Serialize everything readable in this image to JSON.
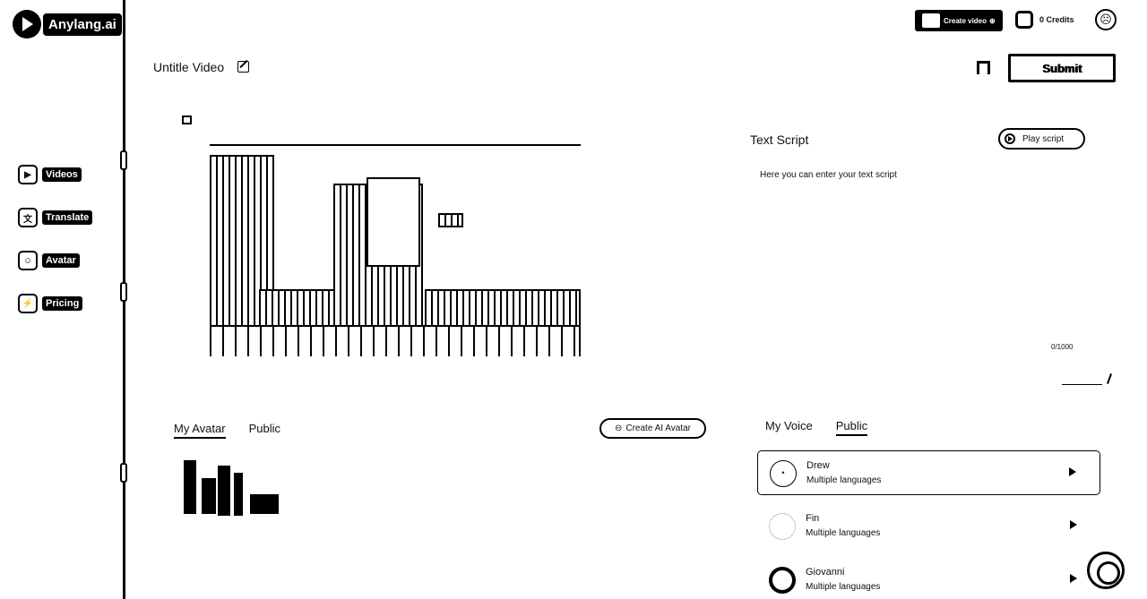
{
  "app": {
    "name": "Anylang.ai"
  },
  "sidebar": {
    "items": [
      {
        "label": "Videos",
        "icon": "play-icon"
      },
      {
        "label": "Translate",
        "icon": "translate-icon"
      },
      {
        "label": "Avatar",
        "icon": "avatar-icon"
      },
      {
        "label": "Pricing",
        "icon": "lightning-icon"
      }
    ]
  },
  "topbar": {
    "create_video_label": "Create video",
    "credits_label": "0 Credits"
  },
  "editor": {
    "video_title": "Untitle Video",
    "submit_label": "Submit"
  },
  "script": {
    "title": "Text Script",
    "play_label": "Play script",
    "placeholder": "Here you can enter your text script",
    "counter": "0/1000"
  },
  "avatar_panel": {
    "tabs": [
      "My Avatar",
      "Public"
    ],
    "active_tab": "My Avatar",
    "create_label": "Create AI Avatar"
  },
  "voice_panel": {
    "tabs": [
      "My Voice",
      "Public"
    ],
    "active_tab": "Public",
    "voices": [
      {
        "name": "Drew",
        "languages": "Multiple languages"
      },
      {
        "name": "Fin",
        "languages": "Multiple languages"
      },
      {
        "name": "Giovanni",
        "languages": "Multiple languages"
      }
    ]
  }
}
